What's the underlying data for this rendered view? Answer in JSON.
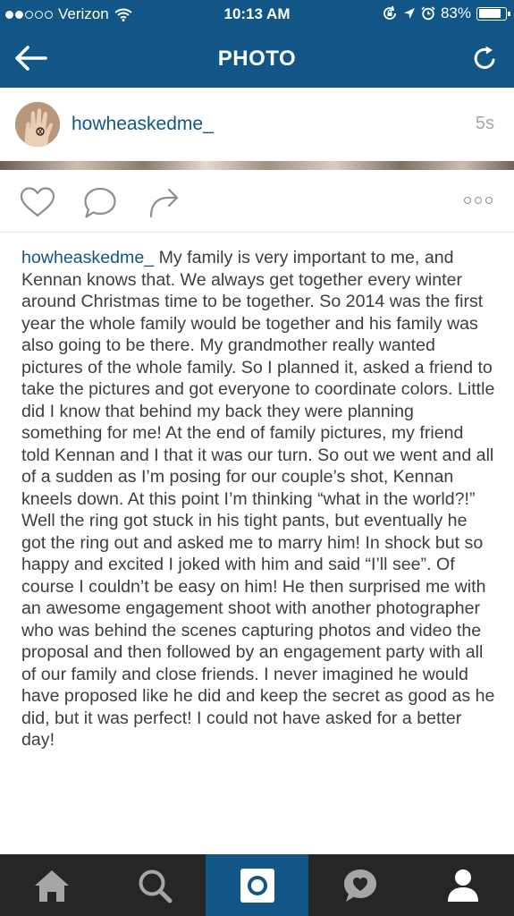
{
  "status_bar": {
    "carrier": "Verizon",
    "time": "10:13 AM",
    "battery": "83%",
    "battery_level": 0.83,
    "signal_bars_filled": 2,
    "signal_bars_total": 5
  },
  "nav": {
    "title": "PHOTO",
    "back_icon": "arrow-left-icon",
    "refresh_icon": "refresh-icon"
  },
  "post": {
    "username": "howheaskedme_",
    "timestamp": "5s"
  },
  "actions": {
    "like_icon": "heart-icon",
    "comment_icon": "comment-icon",
    "share_icon": "share-icon",
    "more_icon": "more-icon"
  },
  "caption": {
    "username": "howheaskedme_",
    "text": " My family is very important to me, and Kennan knows that. We always get together every winter around Christmas time to be together. So 2014 was the first year the whole family would be together and his family was also going to be there. My grandmother really wanted pictures of the whole family. So I planned it, asked a friend to take the pictures and got everyone to coordinate colors. Little did I know that behind my back they were planning something for me! At the end of family pictures, my friend told Kennan and I that it was our turn. So out we went and all of a sudden as I’m posing for our couple’s shot, Kennan kneels down. At this point I’m thinking “what in the world?!” Well the ring got stuck in his tight pants, but eventually he got the ring out and asked me to marry him! In shock but so happy and excited I joked with him and said “I’ll see”. Of course I couldn’t be easy on him! He then surprised me with an awesome engagement shoot with another photographer who was behind the scenes capturing photos and video the proposal and then followed by an engagement party with all of our family and close friends. I never imagined he would have proposed like he did and keep the secret as good as he did, but it was perfect! I could not have asked for a better day!"
  },
  "tab_bar": {
    "tabs": [
      "home-icon",
      "search-icon",
      "camera-icon",
      "activity-icon",
      "profile-icon"
    ],
    "active_index": 2
  },
  "colors": {
    "brand": "#125688",
    "tab_bar": "#262626",
    "tab_icon": "#a6a6a6",
    "text": "#3e3e3e",
    "muted": "#a8a8a8"
  }
}
